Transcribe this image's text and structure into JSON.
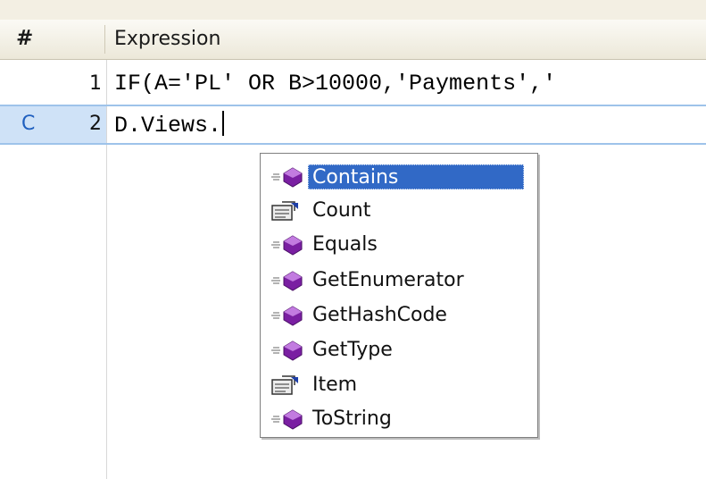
{
  "grid": {
    "header": {
      "hash": "#",
      "expression": "Expression"
    },
    "rows": [
      {
        "num": "1",
        "tag": "",
        "expression": "IF(A='PL' OR B>10000,'Payments','"
      },
      {
        "num": "2",
        "tag": "C",
        "expression": "D.Views."
      }
    ]
  },
  "autocomplete": {
    "selected": "Contains",
    "items": [
      {
        "label": "Contains",
        "icon": "method-icon"
      },
      {
        "label": "Count",
        "icon": "property-icon"
      },
      {
        "label": "Equals",
        "icon": "method-icon"
      },
      {
        "label": "GetEnumerator",
        "icon": "method-icon"
      },
      {
        "label": "GetHashCode",
        "icon": "method-icon"
      },
      {
        "label": "GetType",
        "icon": "method-icon"
      },
      {
        "label": "Item",
        "icon": "property-icon"
      },
      {
        "label": "ToString",
        "icon": "method-icon"
      }
    ]
  },
  "colors": {
    "selection": "#3169c6",
    "current_row": "#cfe2f7",
    "method_icon": "#7a1fa2"
  }
}
